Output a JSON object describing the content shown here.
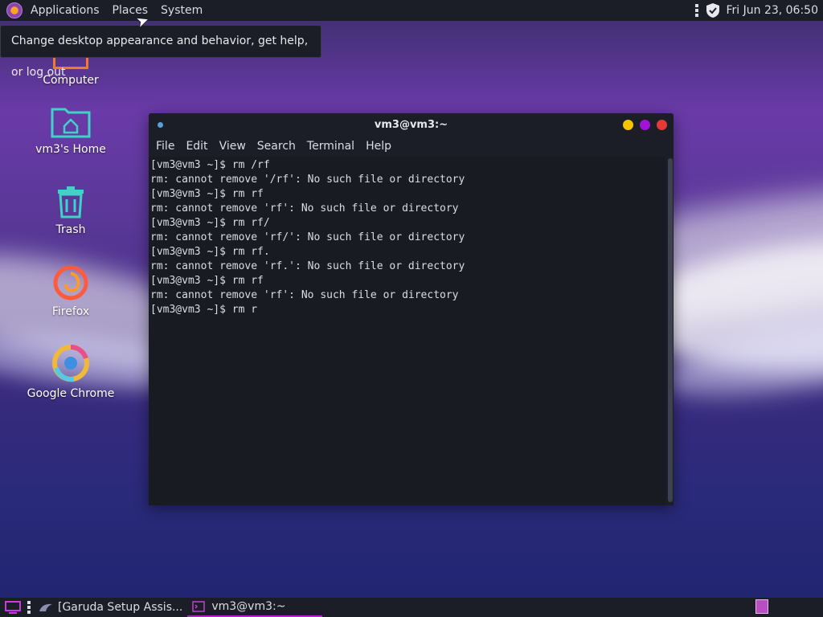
{
  "top_panel": {
    "menu": [
      "Applications",
      "Places",
      "System"
    ],
    "clock": "Fri Jun 23, 06:50"
  },
  "tooltip": "Change desktop appearance and behavior, get help, or log out",
  "desktop_icons": [
    {
      "label": "Computer",
      "icon": "computer-icon"
    },
    {
      "label": "vm3's Home",
      "icon": "home-folder-icon"
    },
    {
      "label": "Trash",
      "icon": "trash-icon"
    },
    {
      "label": "Firefox",
      "icon": "firefox-icon"
    },
    {
      "label": "Google Chrome",
      "icon": "chrome-icon"
    }
  ],
  "terminal": {
    "title": "vm3@vm3:~",
    "menu": [
      "File",
      "Edit",
      "View",
      "Search",
      "Terminal",
      "Help"
    ],
    "lines": [
      "[vm3@vm3 ~]$ rm /rf",
      "rm: cannot remove '/rf': No such file or directory",
      "[vm3@vm3 ~]$ rm rf",
      "rm: cannot remove 'rf': No such file or directory",
      "[vm3@vm3 ~]$ rm rf/",
      "rm: cannot remove 'rf/': No such file or directory",
      "[vm3@vm3 ~]$ rm rf.",
      "rm: cannot remove 'rf.': No such file or directory",
      "[vm3@vm3 ~]$ rm rf",
      "rm: cannot remove 'rf': No such file or directory",
      "[vm3@vm3 ~]$ rm r"
    ],
    "button_colors": [
      "#f5c400",
      "#a213d8",
      "#e53935"
    ]
  },
  "taskbar": {
    "tasks": [
      {
        "label": "[Garuda Setup Assis...",
        "active": false
      },
      {
        "label": "vm3@vm3:~",
        "active": true
      }
    ]
  }
}
